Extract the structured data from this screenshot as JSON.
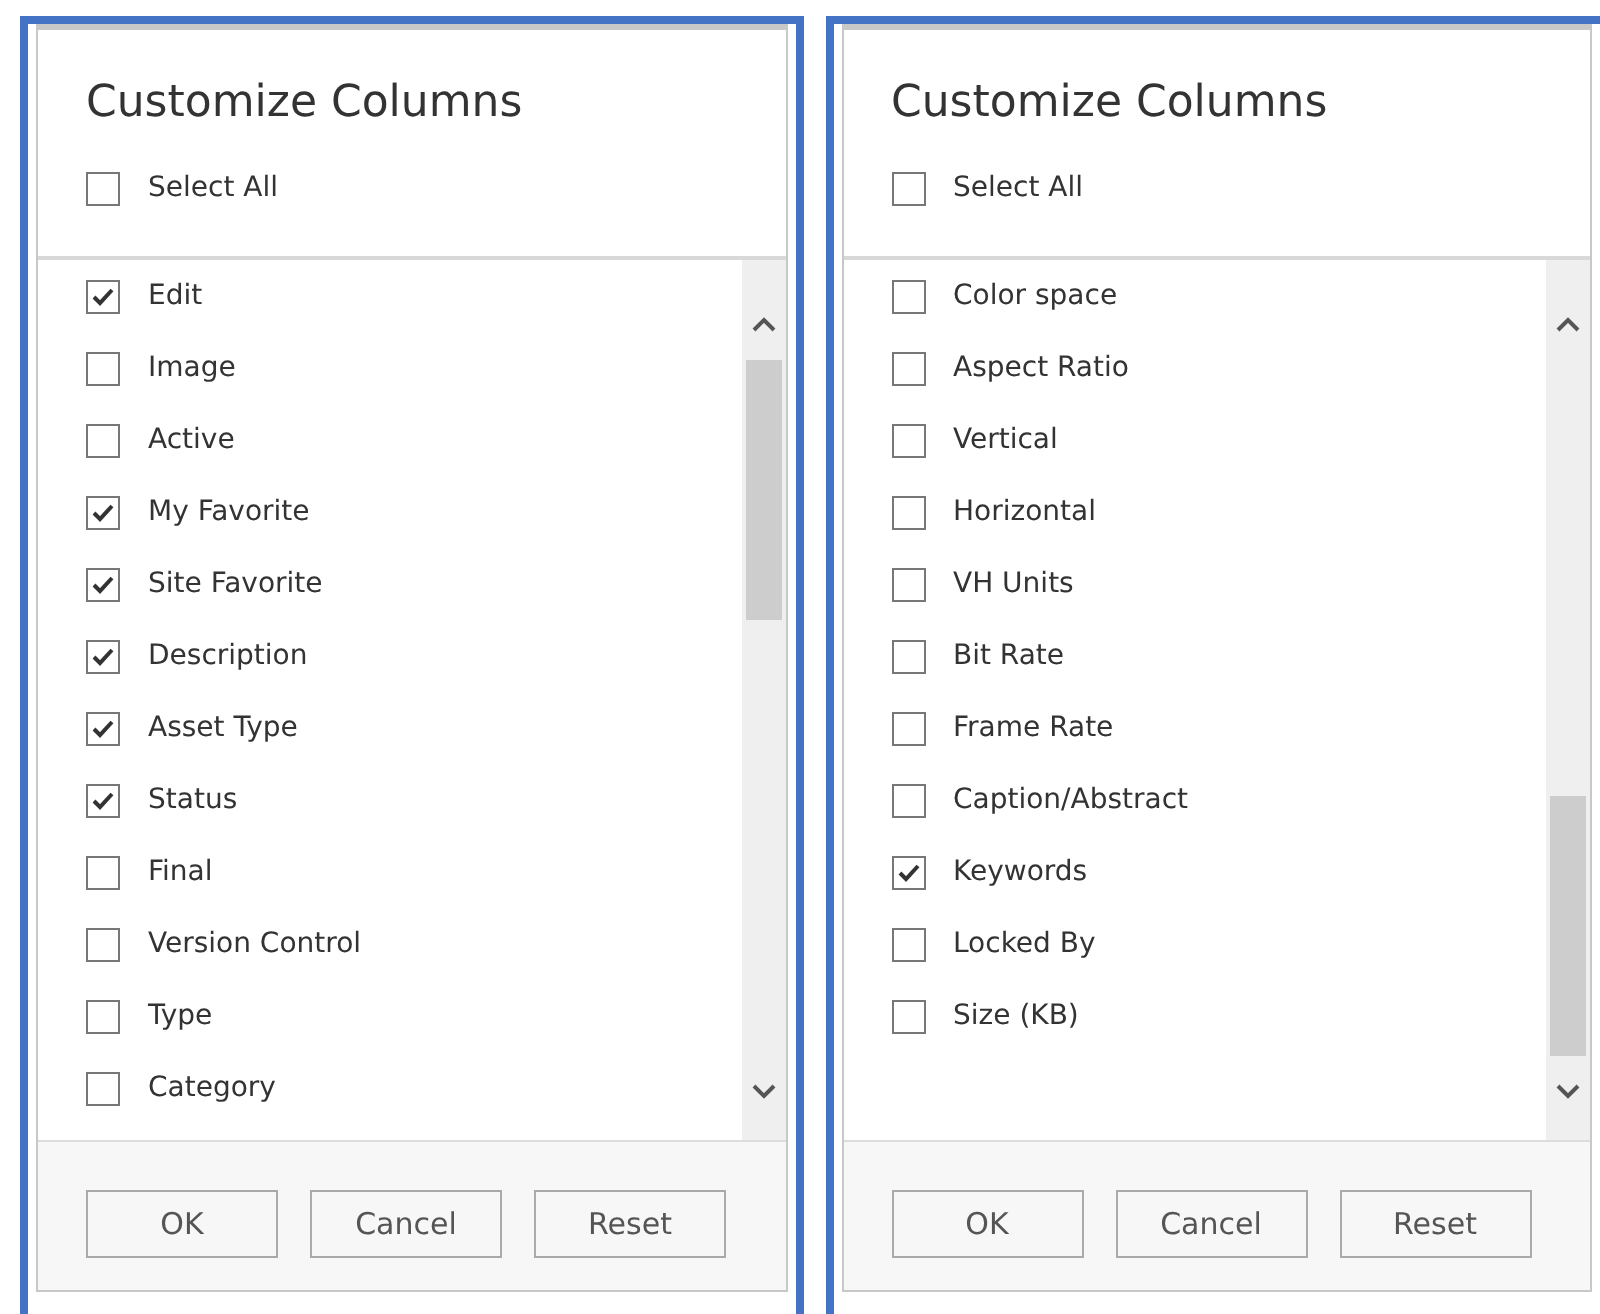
{
  "panels": [
    {
      "title": "Customize Columns",
      "select_all": {
        "label": "Select All",
        "checked": false
      },
      "columns": [
        {
          "label": "Edit",
          "checked": true
        },
        {
          "label": "Image",
          "checked": false
        },
        {
          "label": "Active",
          "checked": false
        },
        {
          "label": "My Favorite",
          "checked": true
        },
        {
          "label": "Site Favorite",
          "checked": true
        },
        {
          "label": "Description",
          "checked": true
        },
        {
          "label": "Asset Type",
          "checked": true
        },
        {
          "label": "Status",
          "checked": true
        },
        {
          "label": "Final",
          "checked": false
        },
        {
          "label": "Version Control",
          "checked": false
        },
        {
          "label": "Type",
          "checked": false
        },
        {
          "label": "Category",
          "checked": false
        }
      ],
      "buttons": [
        "OK",
        "Cancel",
        "Reset"
      ]
    },
    {
      "title": "Customize Columns",
      "select_all": {
        "label": "Select All",
        "checked": false
      },
      "columns": [
        {
          "label": "Color space",
          "checked": false
        },
        {
          "label": "Aspect Ratio",
          "checked": false
        },
        {
          "label": "Vertical",
          "checked": false
        },
        {
          "label": "Horizontal",
          "checked": false
        },
        {
          "label": "VH Units",
          "checked": false
        },
        {
          "label": "Bit Rate",
          "checked": false
        },
        {
          "label": "Frame Rate",
          "checked": false
        },
        {
          "label": "Caption/Abstract",
          "checked": false
        },
        {
          "label": "Keywords",
          "checked": true
        },
        {
          "label": "Locked By",
          "checked": false
        },
        {
          "label": "Size (KB)",
          "checked": false
        }
      ],
      "buttons": [
        "OK",
        "Cancel",
        "Reset"
      ]
    }
  ]
}
